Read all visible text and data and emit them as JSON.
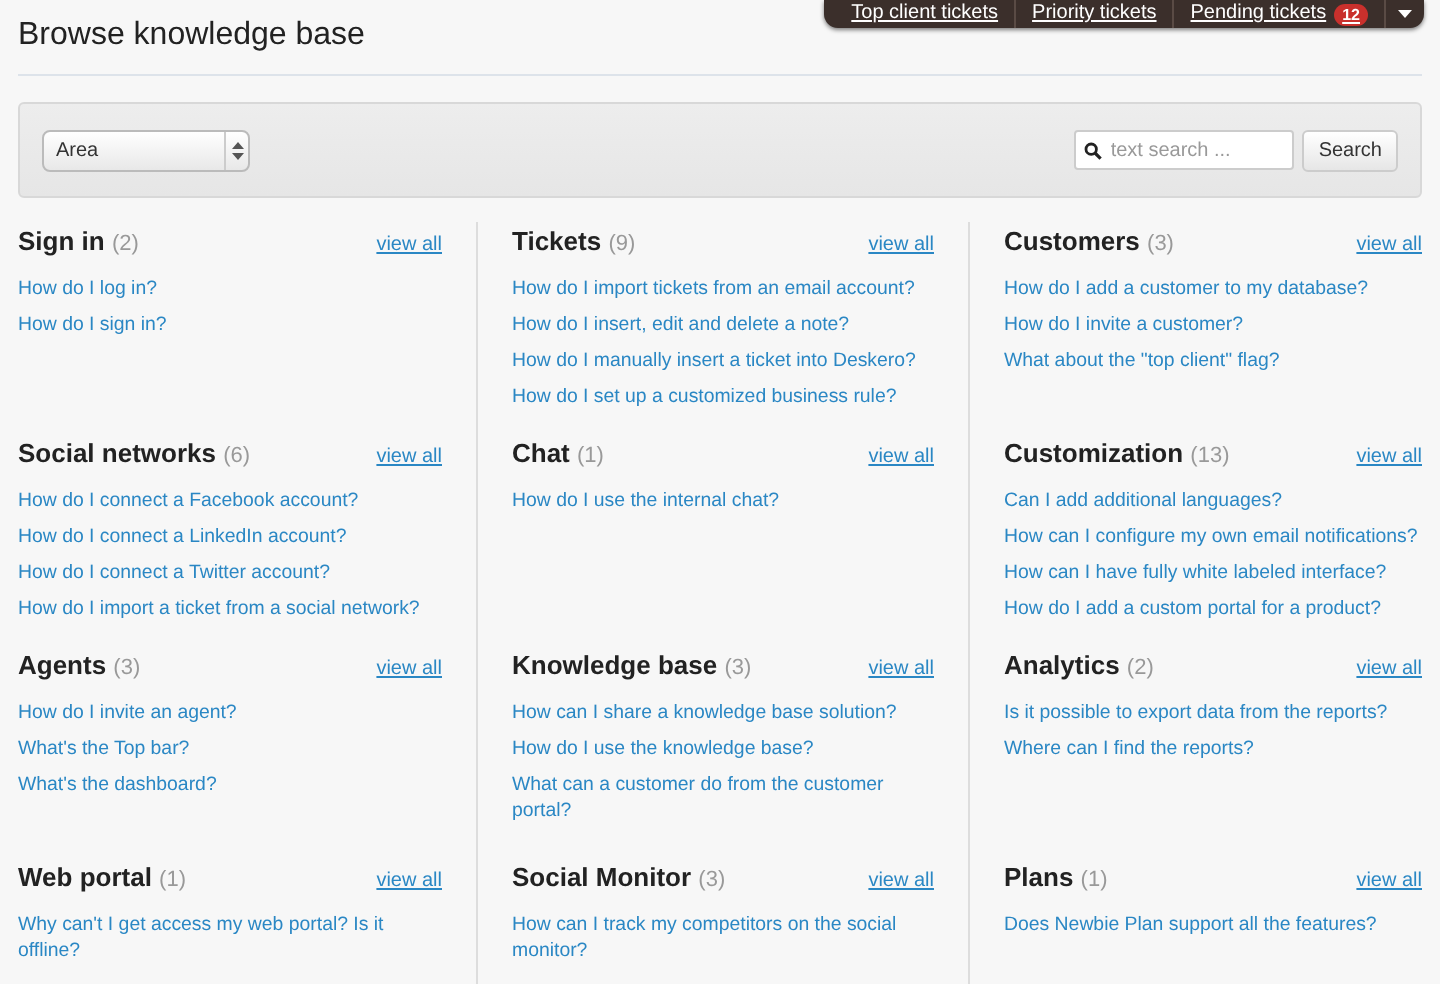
{
  "top_bar": {
    "items": [
      {
        "label": "Top client tickets"
      },
      {
        "label": "Priority tickets"
      },
      {
        "label": "Pending tickets",
        "badge": "12"
      }
    ]
  },
  "title": "Browse knowledge base",
  "filter": {
    "area_select": "Area",
    "search": {
      "placeholder": "text search ..."
    },
    "search_button": "Search"
  },
  "sections": [
    {
      "title": "Sign in",
      "count": "(2)",
      "view_all": "view all",
      "links": [
        "How do I log in?",
        "How do I sign in?"
      ]
    },
    {
      "title": "Tickets",
      "count": "(9)",
      "view_all": "view all",
      "links": [
        "How do I import tickets from an email account?",
        "How do I insert, edit and delete a note?",
        "How do I manually insert a ticket into Deskero?",
        "How do I set up a customized business rule?"
      ]
    },
    {
      "title": "Customers",
      "count": "(3)",
      "view_all": "view all",
      "links": [
        "How do I add a customer to my database?",
        "How do I invite a customer?",
        "What about the \"top client\" flag?"
      ]
    },
    {
      "title": "Social networks",
      "count": "(6)",
      "view_all": "view all",
      "links": [
        "How do I connect a Facebook account?",
        "How do I connect a LinkedIn account?",
        "How do I connect a Twitter account?",
        "How do I import a ticket from a social network?"
      ]
    },
    {
      "title": "Chat",
      "count": "(1)",
      "view_all": "view all",
      "links": [
        "How do I use the internal chat?"
      ]
    },
    {
      "title": "Customization",
      "count": "(13)",
      "view_all": "view all",
      "links": [
        "Can I add additional languages?",
        "How can I configure my own email notifications?",
        "How can I have fully white labeled interface?",
        "How do I add a custom portal for a product?"
      ]
    },
    {
      "title": "Agents",
      "count": "(3)",
      "view_all": "view all",
      "links": [
        "How do I invite an agent?",
        "What's the Top bar?",
        "What's the dashboard?"
      ]
    },
    {
      "title": "Knowledge base",
      "count": "(3)",
      "view_all": "view all",
      "links": [
        "How can I share a knowledge base solution?",
        "How do I use the knowledge base?",
        "What can a customer do from the customer portal?"
      ]
    },
    {
      "title": "Analytics",
      "count": "(2)",
      "view_all": "view all",
      "links": [
        "Is it possible to export data from the reports?",
        "Where can I find the reports?"
      ]
    },
    {
      "title": "Web portal",
      "count": "(1)",
      "view_all": "view all",
      "links": [
        "Why can't I get access my web portal? Is it offline?"
      ]
    },
    {
      "title": "Social Monitor",
      "count": "(3)",
      "view_all": "view all",
      "links": [
        "How can I track my competitors on the social monitor?"
      ]
    },
    {
      "title": "Plans",
      "count": "(1)",
      "view_all": "view all",
      "links": [
        "Does Newbie Plan support all the features?"
      ]
    }
  ]
}
